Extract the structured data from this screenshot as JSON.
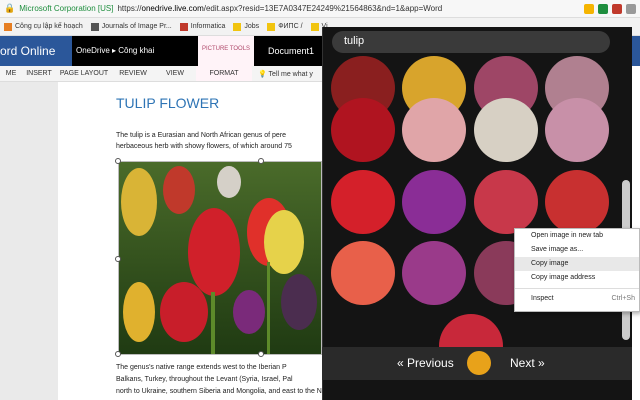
{
  "browser": {
    "secure_label": "Microsoft Corporation [US]",
    "url_prefix": "https://",
    "url_domain": "onedrive.live.com",
    "url_rest": "/edit.aspx?resid=13E7A0347E24249%21564863&nd=1&app=Word",
    "bookmarks": [
      {
        "label": "Công cụ lập kế hoạch"
      },
      {
        "label": "Journals of Image Pr..."
      },
      {
        "label": "Informatica"
      },
      {
        "label": "Jobs"
      },
      {
        "label": "ФИПС /"
      },
      {
        "label": "Vi"
      }
    ]
  },
  "word": {
    "app_name": "ord Online",
    "breadcrumb": "OneDrive ▸ Công khai",
    "picture_tools": "PICTURE TOOLS",
    "doc_name": "Document1",
    "ribbon_tabs": [
      "ME",
      "INSERT",
      "PAGE LAYOUT",
      "REVIEW",
      "VIEW",
      "FORMAT"
    ],
    "tell_me": "Tell me what y"
  },
  "document": {
    "title": "TULIP FLOWER",
    "para1_line1": "The tulip is a Eurasian and North African genus of pere",
    "para1_line2": "herbaceous herb with showy flowers, of which around 75",
    "para2_line1": "The genus's native range extends west to the Iberian P",
    "para2_line2": "Balkans, Turkey, throughout the Levant (Syria, Israel, Pal",
    "para2_line3": "north to Ukraine, southern Siberia and Mongolia, and east to the Northwest of China. The tulip's centre"
  },
  "popup": {
    "search_text": "tulip",
    "prev_label": "« Previous",
    "next_label": "Next »"
  },
  "context_menu": {
    "items": [
      {
        "label": "Open image in new tab"
      },
      {
        "label": "Save image as..."
      },
      {
        "label": "Copy image"
      },
      {
        "label": "Copy image address"
      },
      {
        "label": "Inspect",
        "shortcut": "Ctrl+Sh"
      }
    ]
  },
  "colors": {
    "word_blue": "#2b579a",
    "title_blue": "#2e74b5",
    "popup_bg": "#141414"
  }
}
